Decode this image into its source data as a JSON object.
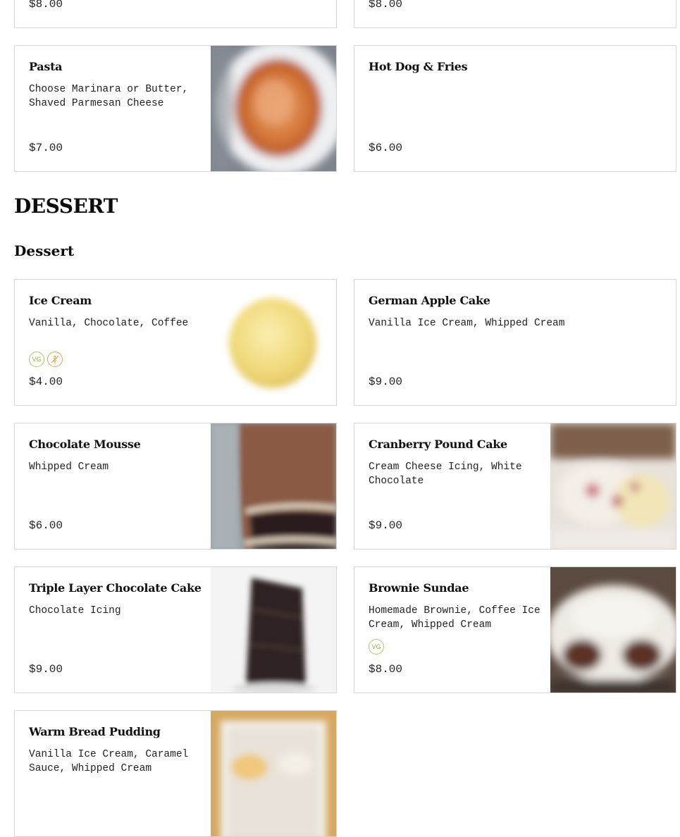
{
  "top_partial": {
    "left_price": "$8.00",
    "right_price": "$8.00"
  },
  "items_above": [
    {
      "name": "Pasta",
      "description": "Choose Marinara or Butter, Shaved Parmesan Cheese",
      "price": "$7.00"
    },
    {
      "name": "Hot Dog & Fries",
      "description": "",
      "price": "$6.00"
    }
  ],
  "section": {
    "title": "DESSERT",
    "subtitle": "Dessert"
  },
  "dessert_items": [
    {
      "name": "Ice Cream",
      "description": "Vanilla, Chocolate, Coffee",
      "price": "$4.00",
      "badges": [
        "VG",
        "GF"
      ]
    },
    {
      "name": "German Apple Cake",
      "description": "Vanilla Ice Cream, Whipped Cream",
      "price": "$9.00"
    },
    {
      "name": "Chocolate Mousse",
      "description": "Whipped Cream",
      "price": "$6.00"
    },
    {
      "name": "Cranberry Pound Cake",
      "description": "Cream Cheese Icing, White Chocolate",
      "price": "$9.00"
    },
    {
      "name": "Triple Layer Chocolate Cake",
      "description": "Chocolate Icing",
      "price": "$9.00"
    },
    {
      "name": "Brownie Sundae",
      "description": "Homemade Brownie, Coffee Ice Cream, Whipped Cream",
      "price": "$8.00",
      "badges": [
        "VG"
      ]
    },
    {
      "name": "Warm Bread Pudding",
      "description": "Vanilla Ice Cream, Caramel Sauce, Whipped Cream",
      "price": ""
    }
  ],
  "colors": {
    "border": "#d6d6d6",
    "vegetarian_badge": "#9aa84a",
    "gluten_free_badge": "#d9a84e"
  }
}
